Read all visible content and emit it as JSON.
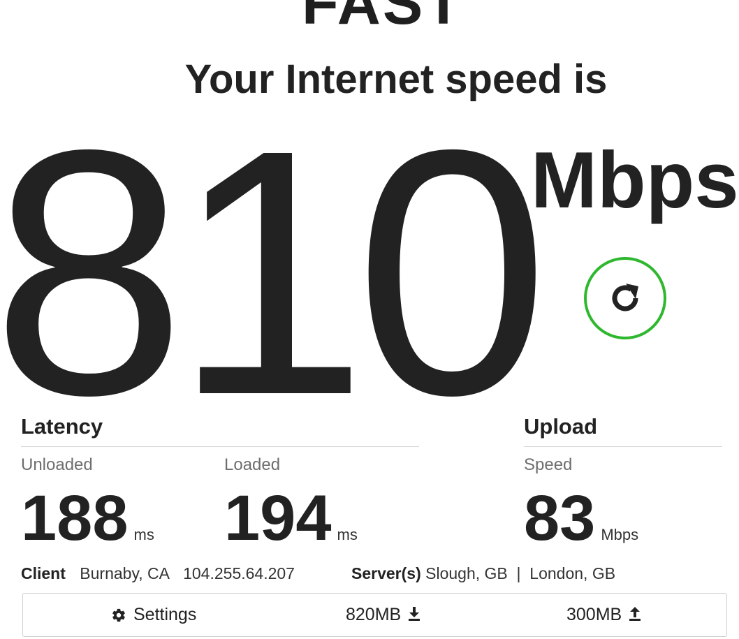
{
  "header": {
    "logo_text": "FAST",
    "headline": "Your Internet speed is"
  },
  "speed": {
    "value": "810",
    "units": "Mbps"
  },
  "refresh": {
    "icon": "refresh-icon",
    "accent_color": "#2eb82e"
  },
  "latency": {
    "title": "Latency",
    "unloaded": {
      "label": "Unloaded",
      "value": "188",
      "unit": "ms"
    },
    "loaded": {
      "label": "Loaded",
      "value": "194",
      "unit": "ms"
    }
  },
  "upload": {
    "title": "Upload",
    "speed": {
      "label": "Speed",
      "value": "83",
      "unit": "Mbps"
    }
  },
  "client_info": {
    "client_label": "Client",
    "location": "Burnaby, CA",
    "ip": "104.255.64.207",
    "servers_label": "Server(s)",
    "servers": "Slough, GB  |  London, GB"
  },
  "settings_bar": {
    "settings_label": "Settings",
    "settings_icon": "gear-icon",
    "download_size": "820MB",
    "download_icon": "download-arrow-icon",
    "upload_size": "300MB",
    "upload_icon": "upload-arrow-icon"
  }
}
